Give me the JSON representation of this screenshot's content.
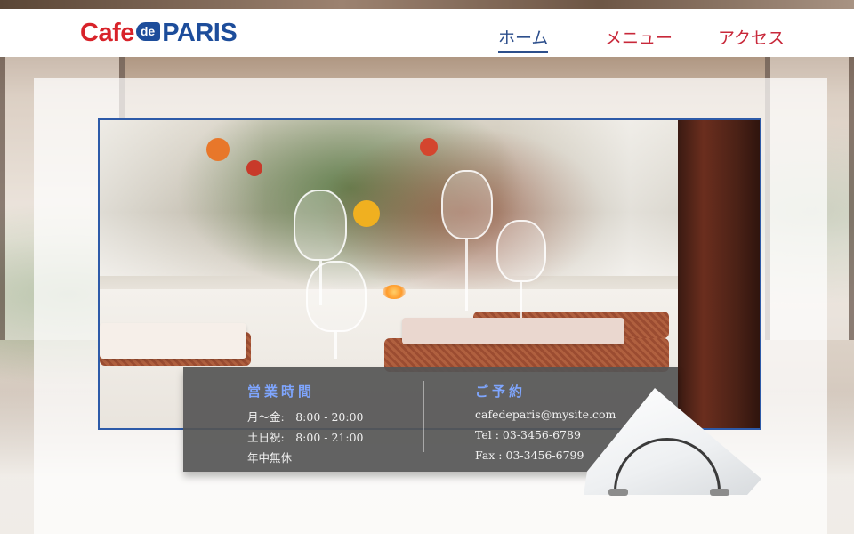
{
  "brand": {
    "logo_part1": "Cafe",
    "logo_part2": "de",
    "logo_part3": "PARIS",
    "colors": {
      "red": "#d8232a",
      "blue": "#1d4d9b"
    }
  },
  "nav": {
    "items": [
      {
        "label": "ホーム",
        "active": true
      },
      {
        "label": "メニュー",
        "active": false
      },
      {
        "label": "アクセス",
        "active": false
      }
    ]
  },
  "info": {
    "hours": {
      "title": "営業時間",
      "lines": [
        "月～金:　8:00 - 20:00",
        "土日祝:　8:00 - 21:00",
        "年中無休"
      ]
    },
    "reservation": {
      "title": "ご予約",
      "lines": [
        "cafedeparis@mysite.com",
        "Tel : 03-3456-6789",
        "Fax : 03-3456-6799"
      ]
    }
  },
  "colors": {
    "nav_active": "#2d4f8c",
    "nav_inactive": "#c8283a",
    "info_title": "#7fa6ff",
    "info_bg": "#555555",
    "hero_border": "#2d5aa8"
  }
}
